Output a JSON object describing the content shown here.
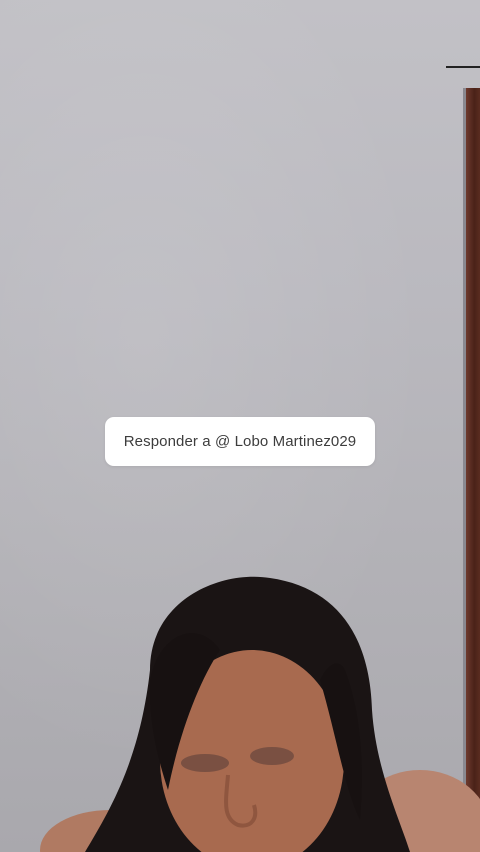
{
  "reply_sticker": {
    "text": "Responder a @ Lobo Martinez029"
  },
  "video": {
    "subject": "person-in-video"
  }
}
